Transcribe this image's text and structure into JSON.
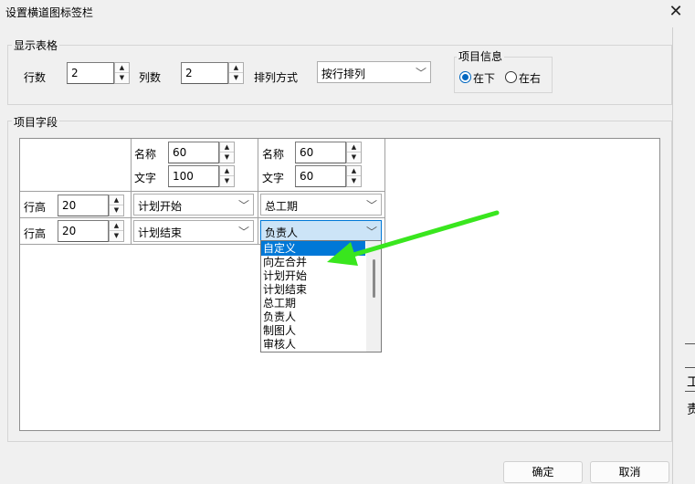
{
  "window": {
    "title": "设置横道图标签栏"
  },
  "display_table": {
    "group_label": "显示表格",
    "rows_label": "行数",
    "rows_value": "2",
    "cols_label": "列数",
    "cols_value": "2",
    "arrange_label": "排列方式",
    "arrange_value": "按行排列"
  },
  "project_info": {
    "group_label": "项目信息",
    "option_below": "在下",
    "option_right": "在右",
    "selected": "在下"
  },
  "project_fields": {
    "group_label": "项目字段",
    "col1": {
      "name_label": "名称",
      "name_value": "60",
      "text_label": "文字",
      "text_value": "100"
    },
    "col2": {
      "name_label": "名称",
      "name_value": "60",
      "text_label": "文字",
      "text_value": "60"
    },
    "row1": {
      "height_label": "行高",
      "height_value": "20",
      "field1": "计划开始",
      "field2": "总工期"
    },
    "row2": {
      "height_label": "行高",
      "height_value": "20",
      "field1": "计划结束",
      "field2": "负责人"
    }
  },
  "dropdown": {
    "items": [
      "自定义",
      "向左合并",
      "计划开始",
      "计划结束",
      "总工期",
      "负责人",
      "制图人",
      "审核人"
    ],
    "highlighted_index": 0
  },
  "background_fragments": {
    "frag1": "工",
    "frag2": "责"
  },
  "buttons": {
    "ok": "确定",
    "cancel": "取消"
  },
  "colors": {
    "accent": "#0067c0",
    "annotation_arrow": "#39e61e",
    "highlight": "#0078d7"
  }
}
